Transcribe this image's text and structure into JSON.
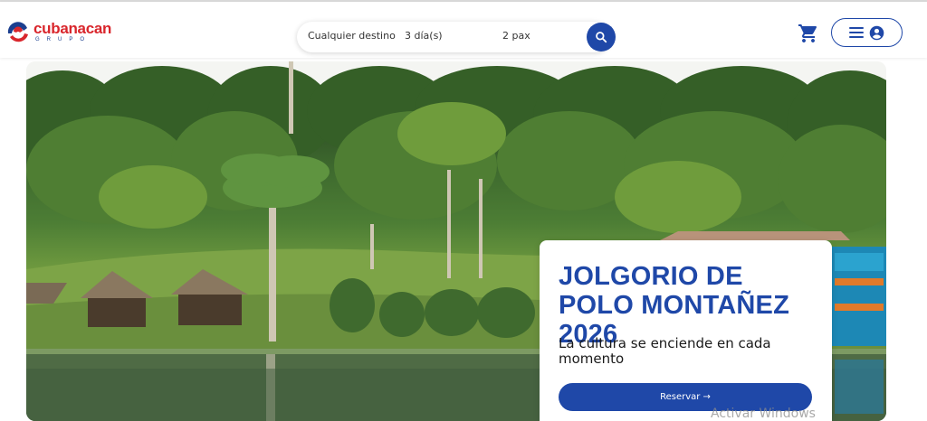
{
  "brand": {
    "name": "cubanacan",
    "sub": "GRUPO",
    "colors": {
      "red": "#d9262c",
      "blue": "#1b3f8f"
    }
  },
  "search": {
    "destination": "Cualquier destino",
    "days": "3 día(s)",
    "pax": "2 pax",
    "icon": "search-icon"
  },
  "header": {
    "cart_icon": "cart-icon",
    "menu_icon": "menu-icon",
    "account_icon": "account-icon",
    "accent": "#1f48a8"
  },
  "promo": {
    "title": "JOLGORIO DE POLO MONTAÑEZ 2026",
    "subtitle": "La cultura se enciende en cada momento",
    "cta": "Reservar →"
  },
  "system": {
    "watermark": "Activar Windows"
  }
}
